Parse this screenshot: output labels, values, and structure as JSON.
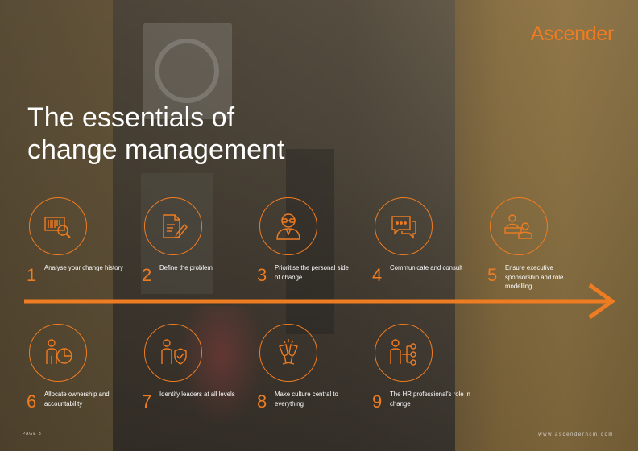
{
  "brand": {
    "logo_text": "Ascender",
    "accent_color": "#ee7c22"
  },
  "title_lines": [
    "The essentials of",
    "change management"
  ],
  "steps": [
    {
      "number": "1",
      "label": "Analyse your change history",
      "icon": "barcode-magnifier-icon"
    },
    {
      "number": "2",
      "label": "Define the problem",
      "icon": "document-pen-icon"
    },
    {
      "number": "3",
      "label": "Prioritise the personal side of change",
      "icon": "person-glasses-icon"
    },
    {
      "number": "4",
      "label": "Communicate and consult",
      "icon": "speech-bubbles-icon"
    },
    {
      "number": "5",
      "label": "Ensure executive sponsorship and role modelling",
      "icon": "presenter-audience-icon"
    },
    {
      "number": "6",
      "label": "Allocate ownership and accountability",
      "icon": "person-pie-chart-icon"
    },
    {
      "number": "7",
      "label": "Identify leaders at all levels",
      "icon": "person-shield-icon"
    },
    {
      "number": "8",
      "label": "Make culture central to everything",
      "icon": "champagne-toast-icon"
    },
    {
      "number": "9",
      "label": "The HR professional's role in change",
      "icon": "person-network-icon"
    }
  ],
  "footer": {
    "page_label": "PAGE 3",
    "website": "www.ascenderhcm.com"
  }
}
